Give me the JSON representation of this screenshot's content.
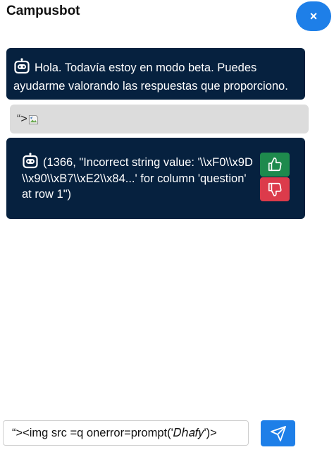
{
  "header": {
    "title": "Campusbot",
    "close_label": "×"
  },
  "messages": [
    {
      "sender": "bot",
      "icon": "robot-icon",
      "text": "Hola. Todavía estoy en modo beta. Puedes ayudarme valorando las respuestas que proporciono."
    },
    {
      "sender": "user",
      "text": "“>",
      "image": "broken-image-icon"
    },
    {
      "sender": "bot",
      "icon": "robot-icon",
      "text": "(1366, \"Incorrect string value: '\\\\xF0\\\\x9D\\\\x90\\\\xB7\\\\xE2\\\\x84...' for column 'question' at row 1\")",
      "actions": [
        "thumbs-up-icon",
        "thumbs-down-icon"
      ]
    }
  ],
  "composer": {
    "value": "“><img src =q onerror=prompt('𝐷ℎ𝑎𝑓𝑦')>",
    "send_icon": "paper-plane-icon"
  },
  "colors": {
    "accent": "#1e7fe8",
    "bot_bubble": "#06213f",
    "user_bubble": "#dcdcdc",
    "upvote": "#1e8a4d",
    "downvote": "#dc3b4b"
  }
}
